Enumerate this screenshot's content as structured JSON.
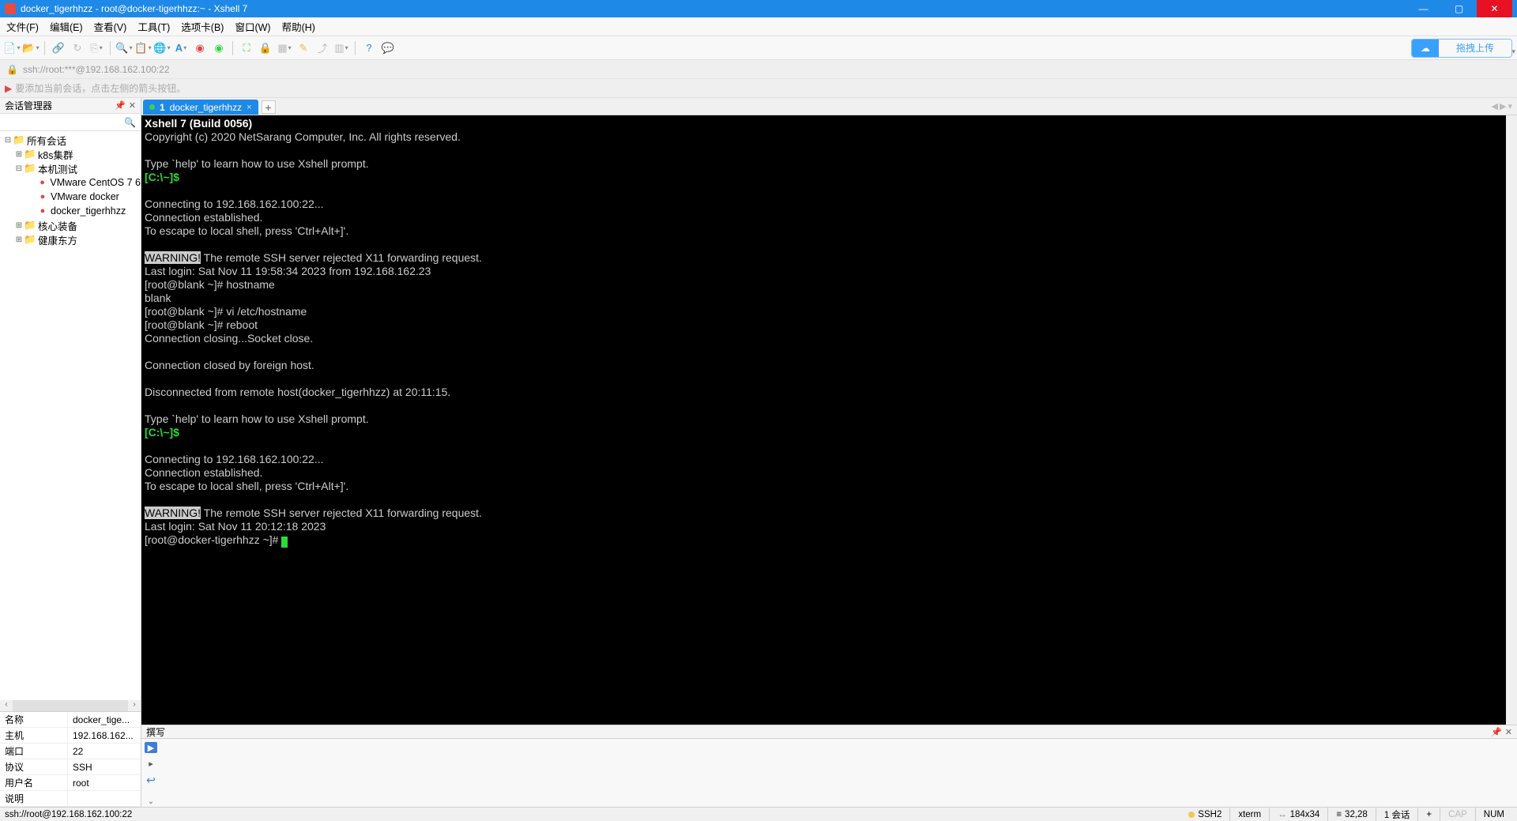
{
  "title": "docker_tigerhhzz - root@docker-tigerhhzz:~ - Xshell 7",
  "menu": [
    "文件(F)",
    "编辑(E)",
    "查看(V)",
    "工具(T)",
    "选项卡(B)",
    "窗口(W)",
    "帮助(H)"
  ],
  "upload_label": "拖拽上传",
  "address": "ssh://root:***@192.168.162.100:22",
  "sessionbar_hint": "要添加当前会话，点击左侧的箭头按钮。",
  "sidebar": {
    "title": "会话管理器",
    "tree": [
      {
        "depth": 0,
        "twist": "-",
        "type": "folder",
        "label": "所有会话"
      },
      {
        "depth": 1,
        "twist": "+",
        "type": "folder",
        "label": "k8s集群"
      },
      {
        "depth": 1,
        "twist": "-",
        "type": "folder",
        "label": "本机测试"
      },
      {
        "depth": 2,
        "twist": "",
        "type": "sess",
        "label": "VMware CentOS 7 6"
      },
      {
        "depth": 2,
        "twist": "",
        "type": "sess",
        "label": "VMware docker"
      },
      {
        "depth": 2,
        "twist": "",
        "type": "sess",
        "label": "docker_tigerhhzz"
      },
      {
        "depth": 1,
        "twist": "+",
        "type": "folder",
        "label": "核心装备"
      },
      {
        "depth": 1,
        "twist": "+",
        "type": "folder",
        "label": "健康东方"
      }
    ],
    "props": [
      {
        "k": "名称",
        "v": "docker_tige..."
      },
      {
        "k": "主机",
        "v": "192.168.162..."
      },
      {
        "k": "端口",
        "v": "22"
      },
      {
        "k": "协议",
        "v": "SSH"
      },
      {
        "k": "用户名",
        "v": "root"
      },
      {
        "k": "说明",
        "v": ""
      }
    ]
  },
  "tab": {
    "num": "1",
    "name": "docker_tigerhhzz"
  },
  "terminal": {
    "l0": "Xshell 7 (Build 0056)",
    "l1": "Copyright (c) 2020 NetSarang Computer, Inc. All rights reserved.",
    "l2": "",
    "l3": "Type `help' to learn how to use Xshell prompt.",
    "l4": "[C:\\~]$",
    "l5": "",
    "l6": "Connecting to 192.168.162.100:22...",
    "l7": "Connection established.",
    "l8": "To escape to local shell, press 'Ctrl+Alt+]'.",
    "l9": "",
    "l10a": "WARNING!",
    "l10b": " The remote SSH server rejected X11 forwarding request.",
    "l11": "Last login: Sat Nov 11 19:58:34 2023 from 192.168.162.23",
    "l12": "[root@blank ~]# hostname",
    "l13": "blank",
    "l14": "[root@blank ~]# vi /etc/hostname",
    "l15": "[root@blank ~]# reboot",
    "l16": "Connection closing...Socket close.",
    "l17": "",
    "l18": "Connection closed by foreign host.",
    "l19": "",
    "l20": "Disconnected from remote host(docker_tigerhhzz) at 20:11:15.",
    "l21": "",
    "l22": "Type `help' to learn how to use Xshell prompt.",
    "l23": "[C:\\~]$",
    "l24": "",
    "l25": "Connecting to 192.168.162.100:22...",
    "l26": "Connection established.",
    "l27": "To escape to local shell, press 'Ctrl+Alt+]'.",
    "l28": "",
    "l29a": "WARNING!",
    "l29b": " The remote SSH server rejected X11 forwarding request.",
    "l30": "Last login: Sat Nov 11 20:12:18 2023",
    "l31": "[root@docker-tigerhhzz ~]# "
  },
  "compose_title": "撰写",
  "status": {
    "left": "ssh://root@192.168.162.100:22",
    "ssh": "SSH2",
    "term": "xterm",
    "size": "184x34",
    "pos": "32,28",
    "sessions": "1 会话",
    "cap": "CAP",
    "num": "NUM"
  }
}
